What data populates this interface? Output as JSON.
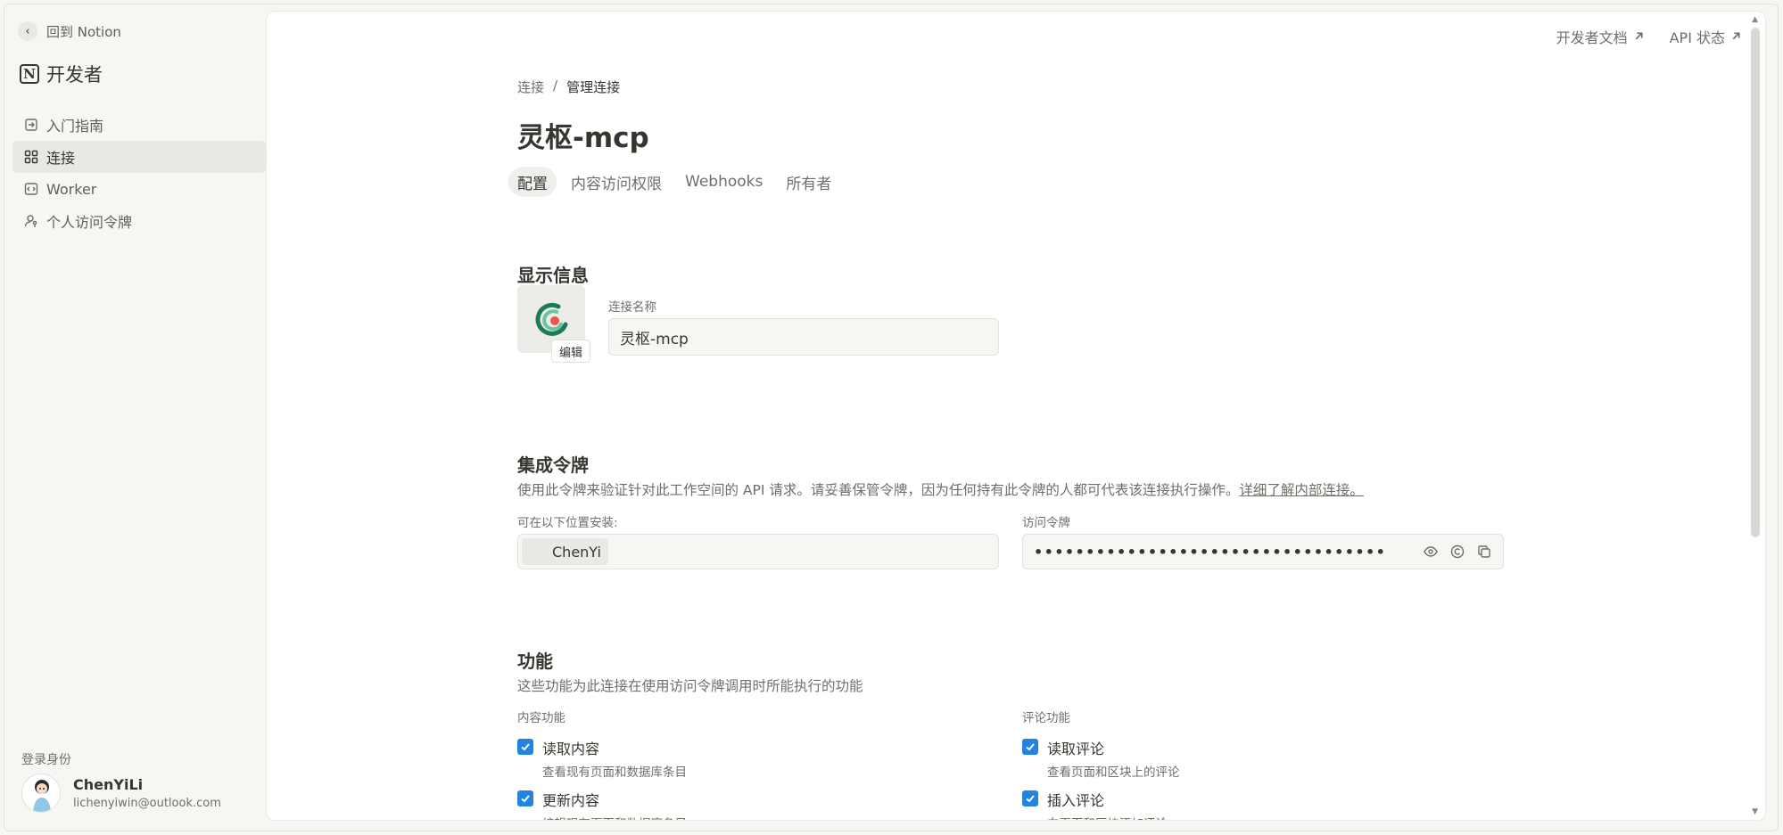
{
  "sidebar": {
    "back_label": "回到 Notion",
    "brand": "开发者",
    "items": [
      {
        "label": "入门指南",
        "icon": "arrow-in-icon"
      },
      {
        "label": "连接",
        "icon": "grid-icon",
        "active": true
      },
      {
        "label": "Worker",
        "icon": "code-icon"
      },
      {
        "label": "个人访问令牌",
        "icon": "person-key-icon"
      }
    ],
    "login_label": "登录身份",
    "user": {
      "name": "ChenYiLi",
      "email": "lichenyiwin@outlook.com"
    }
  },
  "header": {
    "links": [
      {
        "label": "开发者文档"
      },
      {
        "label": "API 状态"
      }
    ]
  },
  "breadcrumb": {
    "parent": "连接",
    "separator": "/",
    "current": "管理连接"
  },
  "page_title": "灵枢-mcp",
  "tabs": [
    {
      "label": "配置",
      "active": true
    },
    {
      "label": "内容访问权限"
    },
    {
      "label": "Webhooks"
    },
    {
      "label": "所有者"
    }
  ],
  "display_info": {
    "title": "显示信息",
    "edit_label": "编辑",
    "name_label": "连接名称",
    "name_value": "灵枢-mcp"
  },
  "token_section": {
    "title": "集成令牌",
    "desc": "使用此令牌来验证针对此工作空间的 API 请求。请妥善保管令牌，因为任何持有此令牌的人都可代表该连接执行操作。",
    "link": "详细了解内部连接。",
    "install_label": "可在以下位置安装:",
    "workspace": "ChenYi",
    "token_label": "访问令牌",
    "token_mask": "••••••••••••••••••••••••••••••••••"
  },
  "capabilities": {
    "title": "功能",
    "desc": "这些功能为此连接在使用访问令牌调用时所能执行的功能",
    "content_label": "内容功能",
    "comment_label": "评论功能",
    "content_items": [
      {
        "label": "读取内容",
        "sub": "查看现有页面和数据库条目",
        "checked": true
      },
      {
        "label": "更新内容",
        "sub": "编辑现有页面和数据库条目",
        "checked": true
      }
    ],
    "comment_items": [
      {
        "label": "读取评论",
        "sub": "查看页面和区块上的评论",
        "checked": true
      },
      {
        "label": "插入评论",
        "sub": "向页面和区块添加评论",
        "checked": true
      }
    ]
  },
  "colors": {
    "accent": "#2383e2",
    "sidebar_bg": "#f7f6f3",
    "active_item": "#e9e8e5"
  }
}
